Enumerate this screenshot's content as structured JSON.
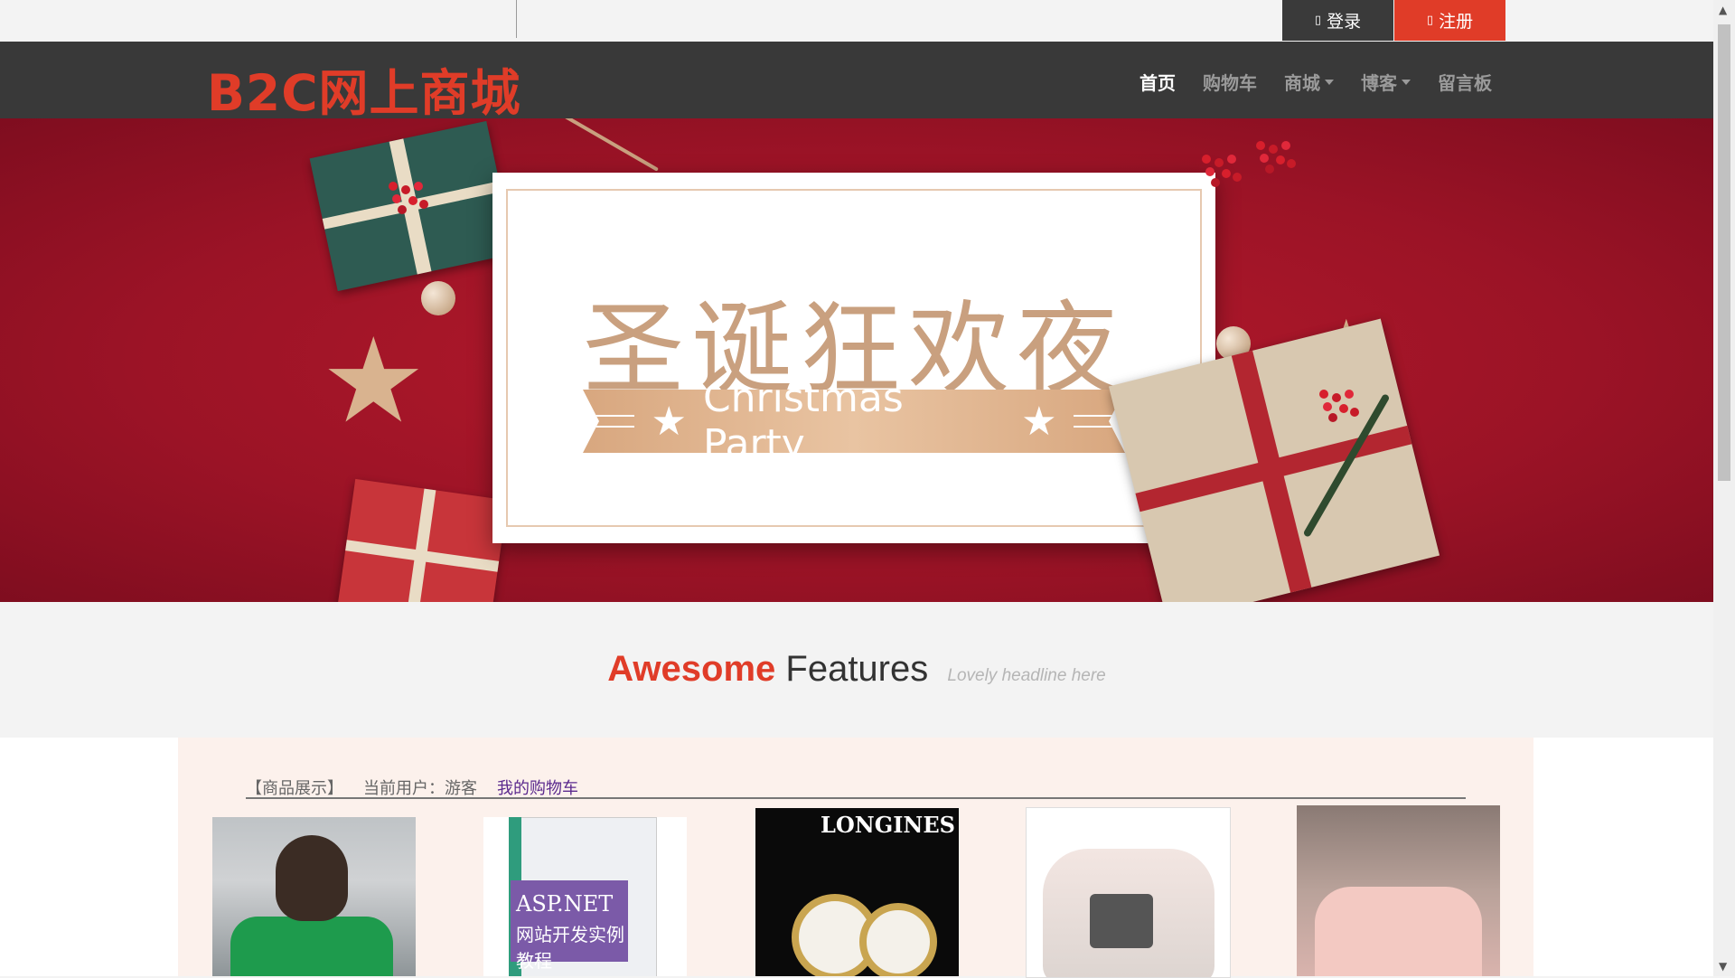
{
  "header": {
    "login_label": "登录",
    "register_label": "注册",
    "login_icon": "user-icon",
    "register_icon": "edit-icon"
  },
  "navbar": {
    "brand": "B2C网上商城",
    "items": [
      {
        "label": "首页",
        "active": true,
        "dropdown": false
      },
      {
        "label": "购物车",
        "active": false,
        "dropdown": false
      },
      {
        "label": "商城",
        "active": false,
        "dropdown": true
      },
      {
        "label": "博客",
        "active": false,
        "dropdown": true
      },
      {
        "label": "留言板",
        "active": false,
        "dropdown": false
      }
    ]
  },
  "banner": {
    "title_cn": "圣诞狂欢夜",
    "title_en": "Christmas Party"
  },
  "features": {
    "highlight": "Awesome",
    "word": "Features",
    "subtitle": "Lovely headline here"
  },
  "products_section": {
    "tab_label": "【商品展示】",
    "user_text": "当前用户：游客",
    "cart_link": "我的购物车"
  },
  "products": [
    {
      "name": "t-shirt-product"
    },
    {
      "name": "book-product",
      "cover_title": "ASP.NET",
      "cover_subtitle": "网站开发实例教程"
    },
    {
      "name": "watch-product",
      "brand": "LONGINES"
    },
    {
      "name": "rice-cooker-product"
    },
    {
      "name": "bedding-product"
    }
  ],
  "colors": {
    "accent": "#e03c28",
    "navbar": "#393939",
    "link": "#5b2a8e"
  }
}
